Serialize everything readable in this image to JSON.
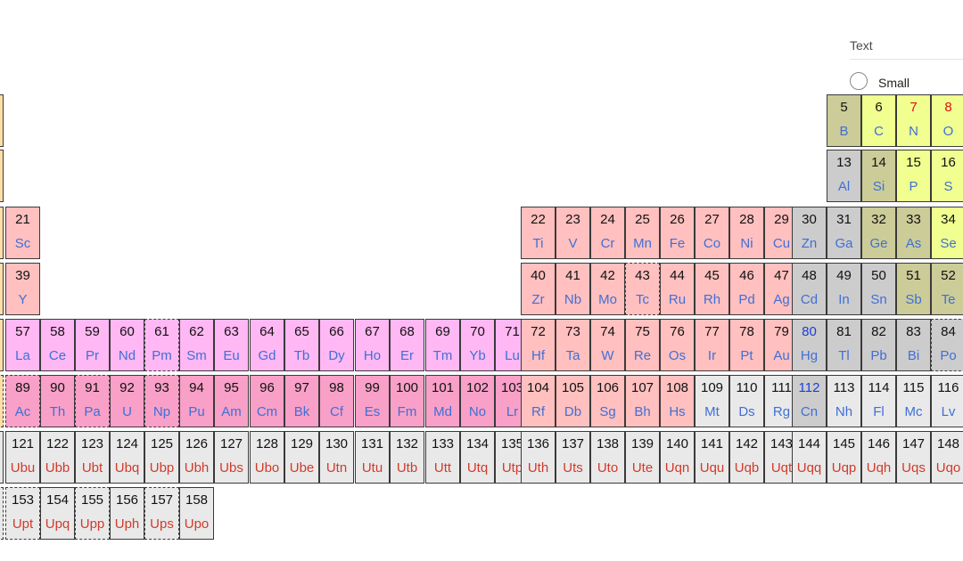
{
  "options_panel": {
    "title": "Text",
    "size_option": {
      "label": "Small",
      "selected": false
    }
  },
  "colors": {
    "alkaline_earth": "#ffdfa8",
    "transition_metal": "#ffc0bf",
    "lanthanide": "#ffb8f4",
    "actinide": "#f8a0c8",
    "metalloid": "#cbcc98",
    "nonmetal": "#f0ff8f",
    "post_transition_metal": "#cccccc",
    "unknown": "#e9e9e9",
    "symbol_blue": "#3f6fd6",
    "symbol_red": "#d23a2a",
    "number_red": "#e01010",
    "number_blue": "#1a3fd8"
  },
  "elements": [
    {
      "num": "5",
      "sym": "B",
      "cat": "metalloid"
    },
    {
      "num": "6",
      "sym": "C",
      "cat": "nonmetal"
    },
    {
      "num": "7",
      "sym": "N",
      "cat": "nonmetal",
      "num_color": "red"
    },
    {
      "num": "8",
      "sym": "O",
      "cat": "nonmetal",
      "num_color": "red"
    },
    {
      "num": "13",
      "sym": "Al",
      "cat": "post"
    },
    {
      "num": "14",
      "sym": "Si",
      "cat": "metalloid"
    },
    {
      "num": "15",
      "sym": "P",
      "cat": "nonmetal"
    },
    {
      "num": "16",
      "sym": "S",
      "cat": "nonmetal"
    },
    {
      "num": "21",
      "sym": "Sc",
      "cat": "transition"
    },
    {
      "num": "22",
      "sym": "Ti",
      "cat": "transition"
    },
    {
      "num": "23",
      "sym": "V",
      "cat": "transition"
    },
    {
      "num": "24",
      "sym": "Cr",
      "cat": "transition"
    },
    {
      "num": "25",
      "sym": "Mn",
      "cat": "transition"
    },
    {
      "num": "26",
      "sym": "Fe",
      "cat": "transition"
    },
    {
      "num": "27",
      "sym": "Co",
      "cat": "transition"
    },
    {
      "num": "28",
      "sym": "Ni",
      "cat": "transition"
    },
    {
      "num": "29",
      "sym": "Cu",
      "cat": "transition"
    },
    {
      "num": "30",
      "sym": "Zn",
      "cat": "post"
    },
    {
      "num": "31",
      "sym": "Ga",
      "cat": "post"
    },
    {
      "num": "32",
      "sym": "Ge",
      "cat": "metalloid"
    },
    {
      "num": "33",
      "sym": "As",
      "cat": "metalloid"
    },
    {
      "num": "34",
      "sym": "Se",
      "cat": "nonmetal"
    },
    {
      "num": "39",
      "sym": "Y",
      "cat": "transition"
    },
    {
      "num": "40",
      "sym": "Zr",
      "cat": "transition"
    },
    {
      "num": "41",
      "sym": "Nb",
      "cat": "transition"
    },
    {
      "num": "42",
      "sym": "Mo",
      "cat": "transition"
    },
    {
      "num": "43",
      "sym": "Tc",
      "cat": "transition",
      "dashed": true
    },
    {
      "num": "44",
      "sym": "Ru",
      "cat": "transition"
    },
    {
      "num": "45",
      "sym": "Rh",
      "cat": "transition"
    },
    {
      "num": "46",
      "sym": "Pd",
      "cat": "transition"
    },
    {
      "num": "47",
      "sym": "Ag",
      "cat": "transition"
    },
    {
      "num": "48",
      "sym": "Cd",
      "cat": "post"
    },
    {
      "num": "49",
      "sym": "In",
      "cat": "post"
    },
    {
      "num": "50",
      "sym": "Sn",
      "cat": "post"
    },
    {
      "num": "51",
      "sym": "Sb",
      "cat": "metalloid"
    },
    {
      "num": "52",
      "sym": "Te",
      "cat": "metalloid"
    },
    {
      "num": "57",
      "sym": "La",
      "cat": "lanth"
    },
    {
      "num": "58",
      "sym": "Ce",
      "cat": "lanth"
    },
    {
      "num": "59",
      "sym": "Pr",
      "cat": "lanth"
    },
    {
      "num": "60",
      "sym": "Nd",
      "cat": "lanth"
    },
    {
      "num": "61",
      "sym": "Pm",
      "cat": "lanth",
      "dashed": true
    },
    {
      "num": "62",
      "sym": "Sm",
      "cat": "lanth"
    },
    {
      "num": "63",
      "sym": "Eu",
      "cat": "lanth"
    },
    {
      "num": "64",
      "sym": "Gd",
      "cat": "lanth"
    },
    {
      "num": "65",
      "sym": "Tb",
      "cat": "lanth"
    },
    {
      "num": "66",
      "sym": "Dy",
      "cat": "lanth"
    },
    {
      "num": "67",
      "sym": "Ho",
      "cat": "lanth"
    },
    {
      "num": "68",
      "sym": "Er",
      "cat": "lanth"
    },
    {
      "num": "69",
      "sym": "Tm",
      "cat": "lanth"
    },
    {
      "num": "70",
      "sym": "Yb",
      "cat": "lanth"
    },
    {
      "num": "71",
      "sym": "Lu",
      "cat": "lanth"
    },
    {
      "num": "72",
      "sym": "Hf",
      "cat": "transition"
    },
    {
      "num": "73",
      "sym": "Ta",
      "cat": "transition"
    },
    {
      "num": "74",
      "sym": "W",
      "cat": "transition"
    },
    {
      "num": "75",
      "sym": "Re",
      "cat": "transition"
    },
    {
      "num": "76",
      "sym": "Os",
      "cat": "transition"
    },
    {
      "num": "77",
      "sym": "Ir",
      "cat": "transition"
    },
    {
      "num": "78",
      "sym": "Pt",
      "cat": "transition"
    },
    {
      "num": "79",
      "sym": "Au",
      "cat": "transition"
    },
    {
      "num": "80",
      "sym": "Hg",
      "cat": "post",
      "num_color": "blue"
    },
    {
      "num": "81",
      "sym": "Tl",
      "cat": "post"
    },
    {
      "num": "82",
      "sym": "Pb",
      "cat": "post"
    },
    {
      "num": "83",
      "sym": "Bi",
      "cat": "post"
    },
    {
      "num": "84",
      "sym": "Po",
      "cat": "post",
      "dashed": true
    },
    {
      "num": "89",
      "sym": "Ac",
      "cat": "actin",
      "dashed": true
    },
    {
      "num": "90",
      "sym": "Th",
      "cat": "actin"
    },
    {
      "num": "91",
      "sym": "Pa",
      "cat": "actin",
      "dashed": true
    },
    {
      "num": "92",
      "sym": "U",
      "cat": "actin"
    },
    {
      "num": "93",
      "sym": "Np",
      "cat": "actin",
      "dashed": true
    },
    {
      "num": "94",
      "sym": "Pu",
      "cat": "actin"
    },
    {
      "num": "95",
      "sym": "Am",
      "cat": "actin"
    },
    {
      "num": "96",
      "sym": "Cm",
      "cat": "actin"
    },
    {
      "num": "97",
      "sym": "Bk",
      "cat": "actin"
    },
    {
      "num": "98",
      "sym": "Cf",
      "cat": "actin"
    },
    {
      "num": "99",
      "sym": "Es",
      "cat": "actin"
    },
    {
      "num": "100",
      "sym": "Fm",
      "cat": "actin"
    },
    {
      "num": "101",
      "sym": "Md",
      "cat": "actin"
    },
    {
      "num": "102",
      "sym": "No",
      "cat": "actin"
    },
    {
      "num": "103",
      "sym": "Lr",
      "cat": "actin"
    },
    {
      "num": "104",
      "sym": "Rf",
      "cat": "transition"
    },
    {
      "num": "105",
      "sym": "Db",
      "cat": "transition"
    },
    {
      "num": "106",
      "sym": "Sg",
      "cat": "transition"
    },
    {
      "num": "107",
      "sym": "Bh",
      "cat": "transition"
    },
    {
      "num": "108",
      "sym": "Hs",
      "cat": "transition"
    },
    {
      "num": "109",
      "sym": "Mt",
      "cat": "unknown"
    },
    {
      "num": "110",
      "sym": "Ds",
      "cat": "unknown"
    },
    {
      "num": "111",
      "sym": "Rg",
      "cat": "unknown"
    },
    {
      "num": "112",
      "sym": "Cn",
      "cat": "post",
      "num_color": "blue"
    },
    {
      "num": "113",
      "sym": "Nh",
      "cat": "unknown"
    },
    {
      "num": "114",
      "sym": "Fl",
      "cat": "unknown"
    },
    {
      "num": "115",
      "sym": "Mc",
      "cat": "unknown"
    },
    {
      "num": "116",
      "sym": "Lv",
      "cat": "unknown"
    },
    {
      "num": "121",
      "sym": "Ubu",
      "cat": "unknown",
      "sym_color": "red"
    },
    {
      "num": "122",
      "sym": "Ubb",
      "cat": "unknown",
      "sym_color": "red"
    },
    {
      "num": "123",
      "sym": "Ubt",
      "cat": "unknown",
      "sym_color": "red"
    },
    {
      "num": "124",
      "sym": "Ubq",
      "cat": "unknown",
      "sym_color": "red"
    },
    {
      "num": "125",
      "sym": "Ubp",
      "cat": "unknown",
      "sym_color": "red"
    },
    {
      "num": "126",
      "sym": "Ubh",
      "cat": "unknown",
      "sym_color": "red"
    },
    {
      "num": "127",
      "sym": "Ubs",
      "cat": "unknown",
      "sym_color": "red"
    },
    {
      "num": "128",
      "sym": "Ubo",
      "cat": "unknown",
      "sym_color": "red"
    },
    {
      "num": "129",
      "sym": "Ube",
      "cat": "unknown",
      "sym_color": "red"
    },
    {
      "num": "130",
      "sym": "Utn",
      "cat": "unknown",
      "sym_color": "red"
    },
    {
      "num": "131",
      "sym": "Utu",
      "cat": "unknown",
      "sym_color": "red"
    },
    {
      "num": "132",
      "sym": "Utb",
      "cat": "unknown",
      "sym_color": "red"
    },
    {
      "num": "133",
      "sym": "Utt",
      "cat": "unknown",
      "sym_color": "red"
    },
    {
      "num": "134",
      "sym": "Utq",
      "cat": "unknown",
      "sym_color": "red"
    },
    {
      "num": "135",
      "sym": "Utp",
      "cat": "unknown",
      "sym_color": "red"
    },
    {
      "num": "136",
      "sym": "Uth",
      "cat": "unknown",
      "sym_color": "red"
    },
    {
      "num": "137",
      "sym": "Uts",
      "cat": "unknown",
      "sym_color": "red"
    },
    {
      "num": "138",
      "sym": "Uto",
      "cat": "unknown",
      "sym_color": "red"
    },
    {
      "num": "139",
      "sym": "Ute",
      "cat": "unknown",
      "sym_color": "red"
    },
    {
      "num": "140",
      "sym": "Uqn",
      "cat": "unknown",
      "sym_color": "red"
    },
    {
      "num": "141",
      "sym": "Uqu",
      "cat": "unknown",
      "sym_color": "red"
    },
    {
      "num": "142",
      "sym": "Uqb",
      "cat": "unknown",
      "sym_color": "red"
    },
    {
      "num": "143",
      "sym": "Uqt",
      "cat": "unknown",
      "sym_color": "red"
    },
    {
      "num": "144",
      "sym": "Uqq",
      "cat": "unknown",
      "sym_color": "red"
    },
    {
      "num": "145",
      "sym": "Uqp",
      "cat": "unknown",
      "sym_color": "red"
    },
    {
      "num": "146",
      "sym": "Uqh",
      "cat": "unknown",
      "sym_color": "red"
    },
    {
      "num": "147",
      "sym": "Uqs",
      "cat": "unknown",
      "sym_color": "red"
    },
    {
      "num": "148",
      "sym": "Uqo",
      "cat": "unknown",
      "sym_color": "red"
    },
    {
      "num": "153",
      "sym": "Upt",
      "cat": "unknown",
      "sym_color": "red",
      "dashed": true
    },
    {
      "num": "154",
      "sym": "Upq",
      "cat": "unknown",
      "sym_color": "red"
    },
    {
      "num": "155",
      "sym": "Upp",
      "cat": "unknown",
      "sym_color": "red",
      "dashed": true
    },
    {
      "num": "156",
      "sym": "Uph",
      "cat": "unknown",
      "sym_color": "red"
    },
    {
      "num": "157",
      "sym": "Ups",
      "cat": "unknown",
      "sym_color": "red",
      "dashed": true
    },
    {
      "num": "158",
      "sym": "Upo",
      "cat": "unknown",
      "sym_color": "red"
    }
  ]
}
